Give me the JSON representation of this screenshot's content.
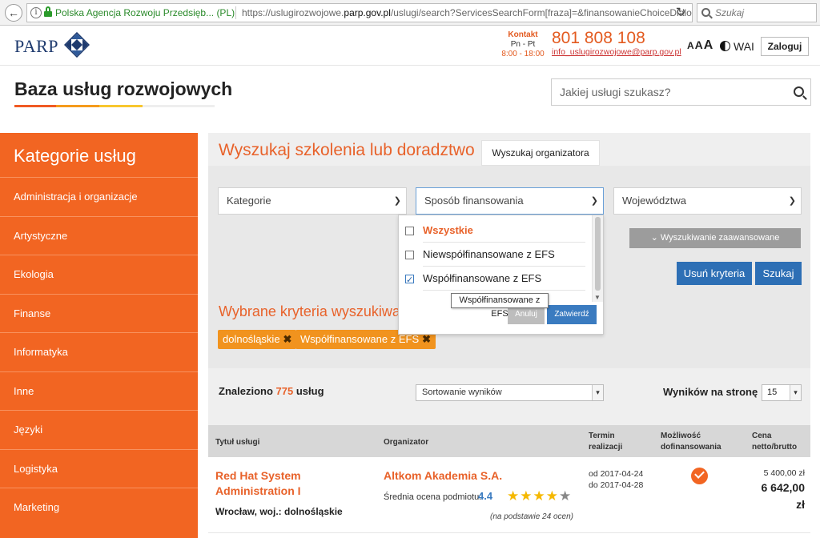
{
  "browser": {
    "site_identity": "Polska Agencja Rozwoju Przedsięb... (PL)",
    "url_prefix": "https://uslugirozwojowe.",
    "url_domain": "parp.gov.pl",
    "url_suffix": "/uslugi/search?ServicesSearchForm[fraza]=&finansowanieChoiceDialo",
    "search_placeholder": "Szukaj"
  },
  "header": {
    "logo_text": "PARP",
    "contact_label": "Kontakt",
    "contact_days": "Pn - Pt",
    "contact_hours": "8:00 - 18:00",
    "phone": "801 808 108",
    "email": "info_uslugirozwojowe@parp.gov.pl",
    "font_small": "A",
    "font_medium": "A",
    "font_large": "A",
    "wai": "WAI",
    "login": "Zaloguj",
    "site_title": "Baza usług rozwojowych",
    "search_placeholder": "Jakiej usługi szukasz?"
  },
  "sidebar": {
    "title": "Kategorie usług",
    "items": [
      "Administracja i organizacje",
      "Artystyczne",
      "Ekologia",
      "Finanse",
      "Informatyka",
      "Inne",
      "Języki",
      "Logistyka",
      "Marketing"
    ]
  },
  "search": {
    "heading": "Wyszukaj szkolenia lub doradztwo",
    "tab_organizer": "Wyszukaj organizatora",
    "select_categories": "Kategorie",
    "select_financing": "Sposób finansowania",
    "select_voivodeship": "Województwa",
    "financing_options": [
      {
        "label": "Wszystkie",
        "checked": false
      },
      {
        "label": "Niewspółfinansowane z EFS",
        "checked": false
      },
      {
        "label": "Współfinansowane z EFS",
        "checked": true
      }
    ],
    "tooltip": "Współfinansowane z EFS",
    "cancel": "Anuluj",
    "confirm": "Zatwierdź",
    "advanced": "Wyszukiwanie zaawansowane",
    "clear": "Usuń kryteria",
    "submit": "Szukaj",
    "chosen_heading": "Wybrane kryteria wyszukiwania",
    "chips": [
      "dolnośląskie",
      "Współfinansowane z EFS"
    ]
  },
  "results": {
    "found_prefix": "Znaleziono",
    "found_count": "775",
    "found_suffix": "usług",
    "sort_label": "Sortowanie wyników",
    "per_page_label": "Wyników na stronę",
    "per_page_value": "15",
    "columns": {
      "title": "Tytuł usługi",
      "organizer": "Organizator",
      "term_1": "Termin",
      "term_2": "realizacji",
      "funding_1": "Możliwość",
      "funding_2": "dofinansowania",
      "price_1": "Cena",
      "price_2": "netto/brutto"
    },
    "rows": [
      {
        "title_line1": "Red Hat System",
        "title_line2": "Administration I",
        "location": "Wrocław, woj.: dolnośląskie",
        "organizer": "Altkom Akademia S.A.",
        "rating_label": "Średnia ocena podmiotu:",
        "rating": "4.4",
        "stars_full": "★★★★",
        "stars_dim": "★",
        "rating_basis": "(na podstawie 24 ocen)",
        "date_from": "od 2017-04-24",
        "date_to": "do 2017-04-28",
        "funded": true,
        "price_net": "5 400,00 zł",
        "price_gross": "6 642,00",
        "price_currency": "zł"
      }
    ]
  },
  "colors": {
    "accent": "#f26522",
    "title_orange": "#e8622a",
    "chip": "#f1931e",
    "button_blue": "#2d6fb5"
  }
}
